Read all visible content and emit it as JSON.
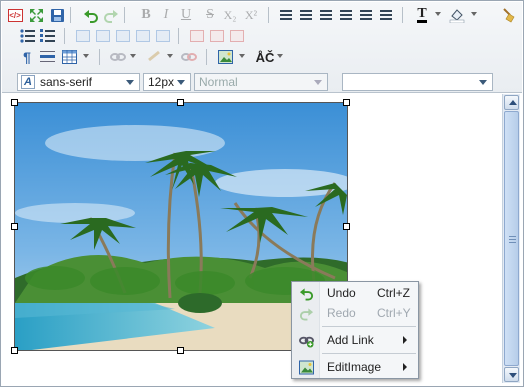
{
  "toolbar": {
    "row1": [
      "source-code",
      "fullscreen",
      "save",
      "undo",
      "redo",
      "bold",
      "italic",
      "underline",
      "strikethrough",
      "subscript",
      "superscript",
      "align-left",
      "align-center",
      "align-justify",
      "align-right",
      "outdent",
      "indent",
      "font-color",
      "highlight-color",
      "clean-format"
    ],
    "row1_glyphs": {
      "bold": "B",
      "italic": "I",
      "underline": "U",
      "strikethrough": "S",
      "subscript": "X₂",
      "superscript": "X²",
      "special_chars": "ÅČ"
    },
    "font_family": "sans-serif",
    "font_size": "12px",
    "format_block": "Normal",
    "style_select": ""
  },
  "context_menu": {
    "items": [
      {
        "label": "Undo",
        "shortcut": "Ctrl+Z",
        "icon": "undo-icon",
        "enabled": true
      },
      {
        "label": "Redo",
        "shortcut": "Ctrl+Y",
        "icon": "redo-icon",
        "enabled": false
      },
      {
        "label": "Add Link",
        "icon": "add-link-icon",
        "enabled": true,
        "submenu": true
      },
      {
        "label": "EditImage",
        "icon": "edit-image-icon",
        "enabled": true,
        "submenu": true
      }
    ]
  },
  "colors": {
    "toolbar_bg": "#eef1f4",
    "accent_blue": "#2d5f9a",
    "scrollbar": "#b6cde9"
  }
}
